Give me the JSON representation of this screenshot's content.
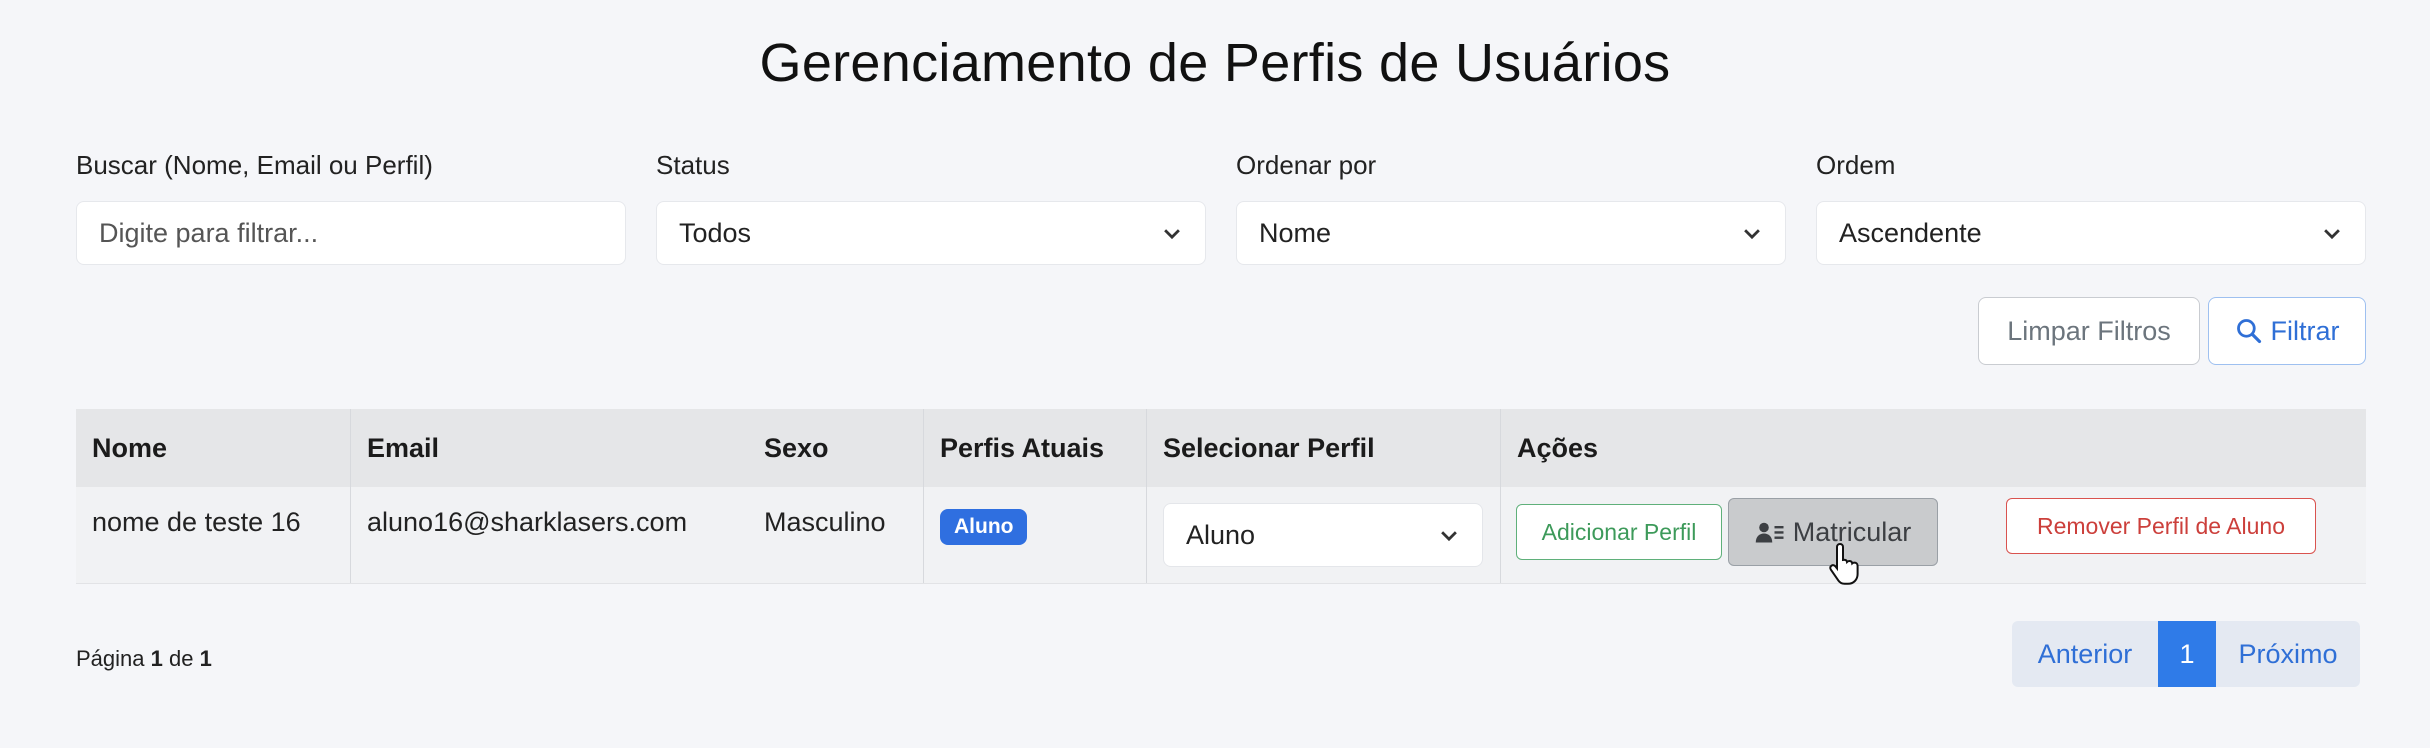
{
  "title": "Gerenciamento de Perfis de Usuários",
  "filters": {
    "search": {
      "label": "Buscar (Nome, Email ou Perfil)",
      "placeholder": "Digite para filtrar..."
    },
    "status": {
      "label": "Status",
      "value": "Todos"
    },
    "sort_by": {
      "label": "Ordenar por",
      "value": "Nome"
    },
    "order": {
      "label": "Ordem",
      "value": "Ascendente"
    }
  },
  "buttons": {
    "clear": "Limpar Filtros",
    "filter": "Filtrar"
  },
  "table": {
    "headers": [
      "Nome",
      "Email",
      "Sexo",
      "Perfis Atuais",
      "Selecionar Perfil",
      "Ações"
    ],
    "rows": [
      {
        "name": "nome de teste 16",
        "email": "aluno16@sharklasers.com",
        "sex": "Masculino",
        "current_profile": "Aluno",
        "selected_profile": "Aluno",
        "actions": {
          "add": "Adicionar Perfil",
          "enroll": "Matricular",
          "remove": "Remover Perfil de Aluno"
        }
      }
    ]
  },
  "pagination": {
    "page_word": "Página",
    "current": "1",
    "of_word": "de",
    "total": "1",
    "prev": "Anterior",
    "next": "Próximo"
  },
  "colors": {
    "primary": "#2f7be8",
    "success": "#3d9a5a",
    "danger": "#cc3f3b",
    "secondary": "#6c757d"
  }
}
